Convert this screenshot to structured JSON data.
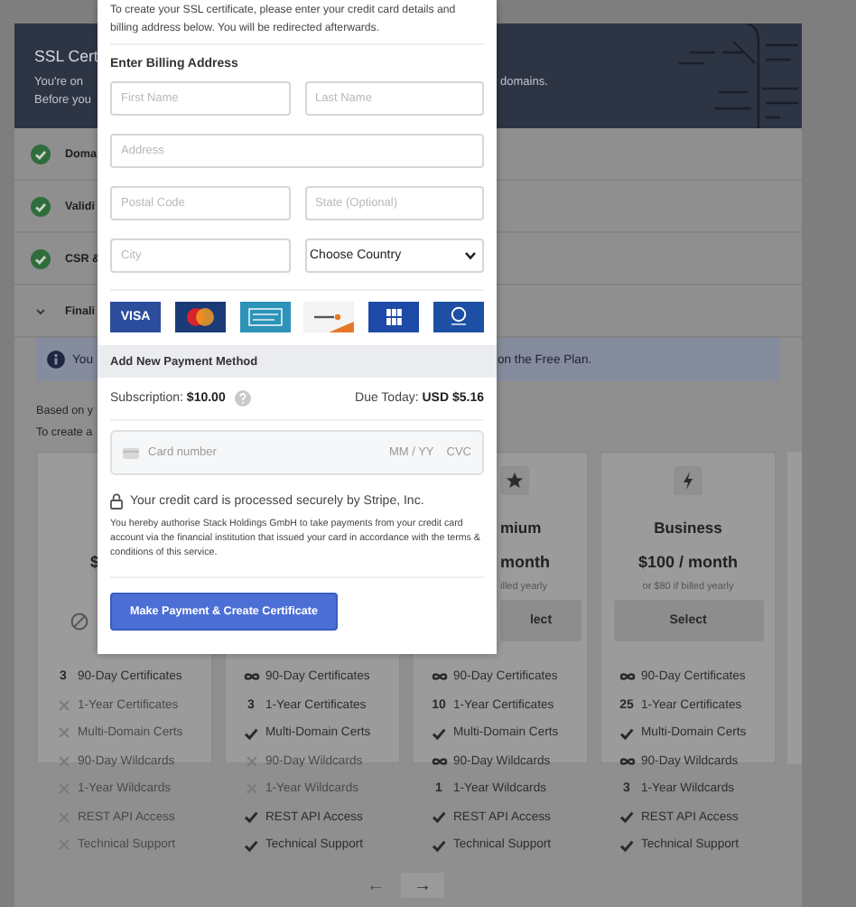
{
  "page": {
    "header": {
      "title": "SSL Cert",
      "line_1": "You're on",
      "line_1_end": "domains.",
      "line_2": "Before you"
    },
    "steps": [
      {
        "label": "Doma",
        "done": true
      },
      {
        "label": "Validi",
        "done": true
      },
      {
        "label": "CSR &",
        "done": true
      },
      {
        "label": "Finali",
        "done": false,
        "expanded": true
      }
    ],
    "notice": {
      "text_start": "You",
      "text_end": "on the Free Plan."
    },
    "intro": [
      "Based on y",
      "To create a"
    ],
    "plans": [
      {
        "price": "$",
        "action": {
          "kind": "blocked"
        },
        "features": [
          {
            "kind": "count",
            "count": "3",
            "text": "90-Day Certificates"
          },
          {
            "kind": "cross",
            "text": "1-Year Certificates"
          },
          {
            "kind": "cross",
            "text": "Multi-Domain Certs"
          },
          {
            "kind": "cross",
            "text": "90-Day Wildcards"
          },
          {
            "kind": "cross",
            "text": "1-Year Wildcards"
          },
          {
            "kind": "cross",
            "text": "REST API Access"
          },
          {
            "kind": "cross",
            "text": "Technical Support"
          }
        ]
      },
      {
        "features": [
          {
            "kind": "infinity",
            "text": "90-Day Certificates"
          },
          {
            "kind": "count",
            "count": "3",
            "text": "1-Year Certificates"
          },
          {
            "kind": "check",
            "text": "Multi-Domain Certs"
          },
          {
            "kind": "cross",
            "text": "90-Day Wildcards"
          },
          {
            "kind": "cross",
            "text": "1-Year Wildcards"
          },
          {
            "kind": "check",
            "text": "REST API Access"
          },
          {
            "kind": "check",
            "text": "Technical Support"
          }
        ]
      },
      {
        "kind": "star",
        "name": "mium",
        "price": "month",
        "note": "illed yearly",
        "action": {
          "kind": "button",
          "label": "lect"
        },
        "features": [
          {
            "kind": "infinity",
            "text": "90-Day Certificates"
          },
          {
            "kind": "count",
            "count": "10",
            "text": "1-Year Certificates"
          },
          {
            "kind": "check",
            "text": "Multi-Domain Certs"
          },
          {
            "kind": "infinity",
            "text": "90-Day Wildcards"
          },
          {
            "kind": "count",
            "count": "1",
            "text": "1-Year Wildcards"
          },
          {
            "kind": "check",
            "text": "REST API Access"
          },
          {
            "kind": "check",
            "text": "Technical Support"
          }
        ]
      },
      {
        "kind": "bolt",
        "name": "Business",
        "price": "$100 / month",
        "note": "or $80 if billed yearly",
        "action": {
          "kind": "button",
          "label": "Select"
        },
        "features": [
          {
            "kind": "infinity",
            "text": "90-Day Certificates"
          },
          {
            "kind": "count",
            "count": "25",
            "text": "1-Year Certificates"
          },
          {
            "kind": "check",
            "text": "Multi-Domain Certs"
          },
          {
            "kind": "infinity",
            "text": "90-Day Wildcards"
          },
          {
            "kind": "count",
            "count": "3",
            "text": "1-Year Wildcards"
          },
          {
            "kind": "check",
            "text": "REST API Access"
          },
          {
            "kind": "check",
            "text": "Technical Support"
          }
        ]
      }
    ],
    "pagination": {
      "prev": {
        "label": "←",
        "disabled": true
      },
      "next": {
        "label": "→",
        "disabled": false
      }
    }
  },
  "modal": {
    "intro": "To create your SSL certificate, please enter your credit card details and billing address below. You will be redirected afterwards.",
    "billing_heading": "Enter Billing Address",
    "fields": [
      {
        "kind": "input",
        "placeholder": "First Name"
      },
      {
        "kind": "input",
        "placeholder": "Last Name"
      },
      {
        "kind": "wide",
        "placeholder": "Address"
      },
      {
        "kind": "input",
        "placeholder": "Postal Code"
      },
      {
        "kind": "input",
        "placeholder": "State (Optional)"
      },
      {
        "kind": "input",
        "placeholder": "City"
      },
      {
        "kind": "select",
        "value": "Choose Country"
      }
    ],
    "card_logos": [
      {
        "kind": "visa",
        "label": "VISA"
      },
      {
        "kind": "mastercard"
      },
      {
        "kind": "amex"
      },
      {
        "kind": "discover"
      },
      {
        "kind": "jcb"
      },
      {
        "kind": "diners"
      }
    ],
    "payment_heading": "Add New Payment Method",
    "subscription": "Subscription: **$10.00**",
    "due": "Due Today: **USD $5.16**",
    "card_field": {
      "placeholder": "Card number",
      "expiry": "MM / YY",
      "cvc": "CVC"
    },
    "secure_note": "Your credit card is processed securely by Stripe, Inc.",
    "authorisation": "You hereby authorise Stack Holdings GmbH to take payments from your credit card account via the financial institution that issued your card in accordance with the terms & conditions of this service.",
    "submit": "Make Payment & Create Certificate"
  }
}
